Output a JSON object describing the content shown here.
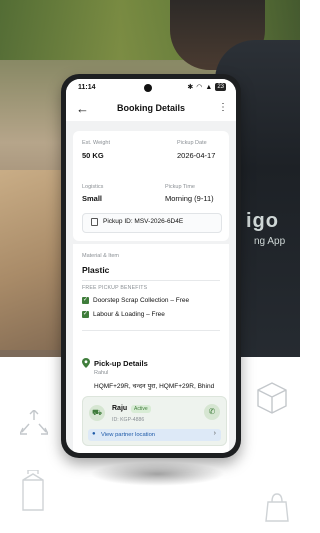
{
  "background": {
    "brand_text": "igo",
    "brand_subtext": "ng App"
  },
  "status_bar": {
    "time": "11:14",
    "battery": "23"
  },
  "app_bar": {
    "title": "Booking Details"
  },
  "booking": {
    "est_weight_label": "Est. Weight",
    "est_weight": "50 KG",
    "pickup_date_label": "Pickup Date",
    "pickup_date": "2026-04-17",
    "logistics_label": "Logistics",
    "logistics": "Small",
    "pickup_time_label": "Pickup Time",
    "pickup_time": "Morning (9-11)",
    "pickup_id": "Pickup ID: MSV-2026-6D4E"
  },
  "material": {
    "label": "Material & Item",
    "value": "Plastic"
  },
  "free_benefits": {
    "heading": "FREE PICKUP BENEFITS",
    "items": [
      "Doorstep Scrap Collection – Free",
      "Labour & Loading – Free"
    ]
  },
  "pickup_details": {
    "title": "Pick-up Details",
    "name": "Rahul",
    "address": "HQMF+29R, चन्दन पुरा, HQMF+29R, Bhind"
  },
  "partner": {
    "name": "Raju",
    "status": "Active",
    "id": "ID: KGP-4886",
    "location_link": "View partner location"
  },
  "colors": {
    "accent_green": "#3f7d3b",
    "link_blue": "#1e5aa8"
  }
}
